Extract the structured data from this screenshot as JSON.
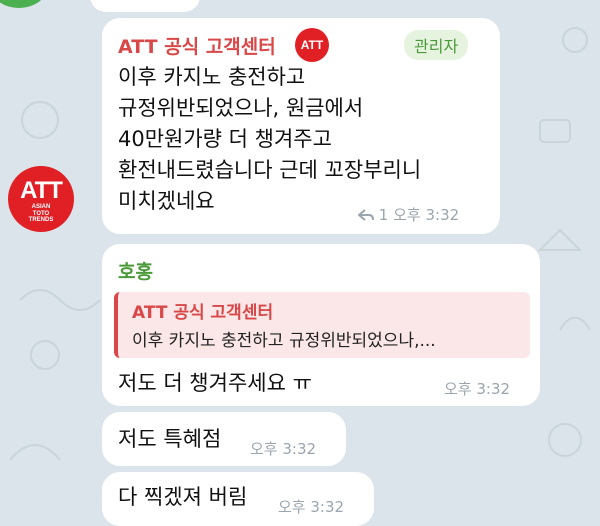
{
  "colors": {
    "background": "#dbe4ea",
    "bubble": "#ffffff",
    "brand_red": "#e02025",
    "sender_green": "#4a9a3a",
    "admin_bg": "#e6f4df",
    "meta_gray": "#9aa5ae"
  },
  "messages": [
    {
      "sender": "ATT 공식 고객센터",
      "badge_icon": "att-logo-icon",
      "badge_text": "ATT",
      "role": "관리자",
      "lines": [
        "이후 카지노 충전하고",
        "규정위반되었으나, 원금에서",
        "40만원가량 더 챙겨주고",
        "환전내드렸습니다 근데 꼬장부리니",
        "미치겠네요"
      ],
      "reply_count": "1",
      "reply_icon": "reply-arrow-icon",
      "time": "오후 3:32"
    },
    {
      "sender": "호홍",
      "quote_sender": "ATT 공식 고객센터",
      "quote_text": "이후 카지노 충전하고 규정위반되었으나,...",
      "text": "저도 더 챙겨주세요 ㅠ",
      "time": "오후 3:32"
    },
    {
      "text": "저도 특혜점",
      "time": "오후 3:32"
    },
    {
      "text": "다 찍겠져 버림",
      "time": "오후 3:32"
    }
  ],
  "avatar": {
    "logo_text": "ATT",
    "logo_sub": [
      "ASIAN",
      "TOTO",
      "TRENDS"
    ]
  }
}
